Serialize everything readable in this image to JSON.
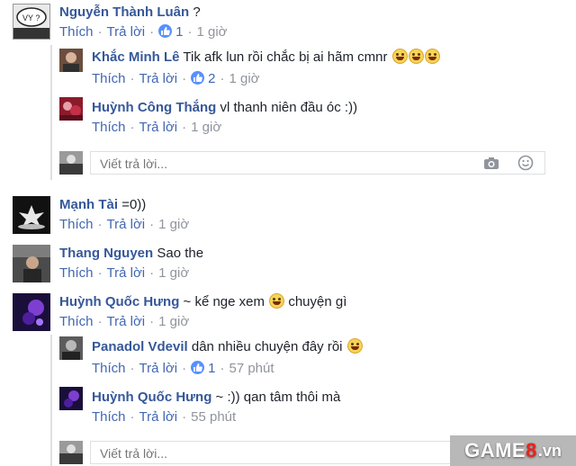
{
  "comments": [
    {
      "author": "Nguyễn Thành Luân",
      "text": "?",
      "like": "Thích",
      "reply": "Trả lời",
      "likes": "1",
      "time": "1 giờ",
      "avatar_text": "VY ?"
    },
    {
      "author": "Khắc Minh Lê",
      "text": "Tik afk lun rồi chắc bị ai hãm cmnr",
      "like": "Thích",
      "reply": "Trả lời",
      "likes": "2",
      "time": "1 giờ"
    },
    {
      "author": "Huỳnh Công Thắng",
      "text": "vl thanh niên đầu óc :))",
      "like": "Thích",
      "reply": "Trả lời",
      "time": "1 giờ"
    },
    {
      "author": "Mạnh Tài",
      "text": "=0))",
      "like": "Thích",
      "reply": "Trả lời",
      "time": "1 giờ"
    },
    {
      "author": "Thang Nguyen",
      "text": "Sao the",
      "like": "Thích",
      "reply": "Trả lời",
      "time": "1 giờ"
    },
    {
      "author": "Huỳnh Quốc Hưng",
      "text_before": "~ kể nge xem",
      "text_after": "chuyện gì",
      "like": "Thích",
      "reply": "Trả lời",
      "time": "1 giờ"
    },
    {
      "author": "Panadol Vdevil",
      "text": "dân nhiều chuyện đây rồi",
      "like": "Thích",
      "reply": "Trả lời",
      "likes": "1",
      "time": "57 phút"
    },
    {
      "author": "Huỳnh Quốc Hưng",
      "text": "~ :)) qan tâm thôi mà",
      "like": "Thích",
      "reply": "Trả lời",
      "time": "55 phút"
    }
  ],
  "reply_placeholder": "Viết trả lời...",
  "watermark": {
    "a": "GAME",
    "b": "8",
    "c": ".vn"
  },
  "colors": {
    "link": "#365899",
    "action": "#4267b2",
    "meta": "#90949c",
    "like_badge": "#5890ff"
  }
}
